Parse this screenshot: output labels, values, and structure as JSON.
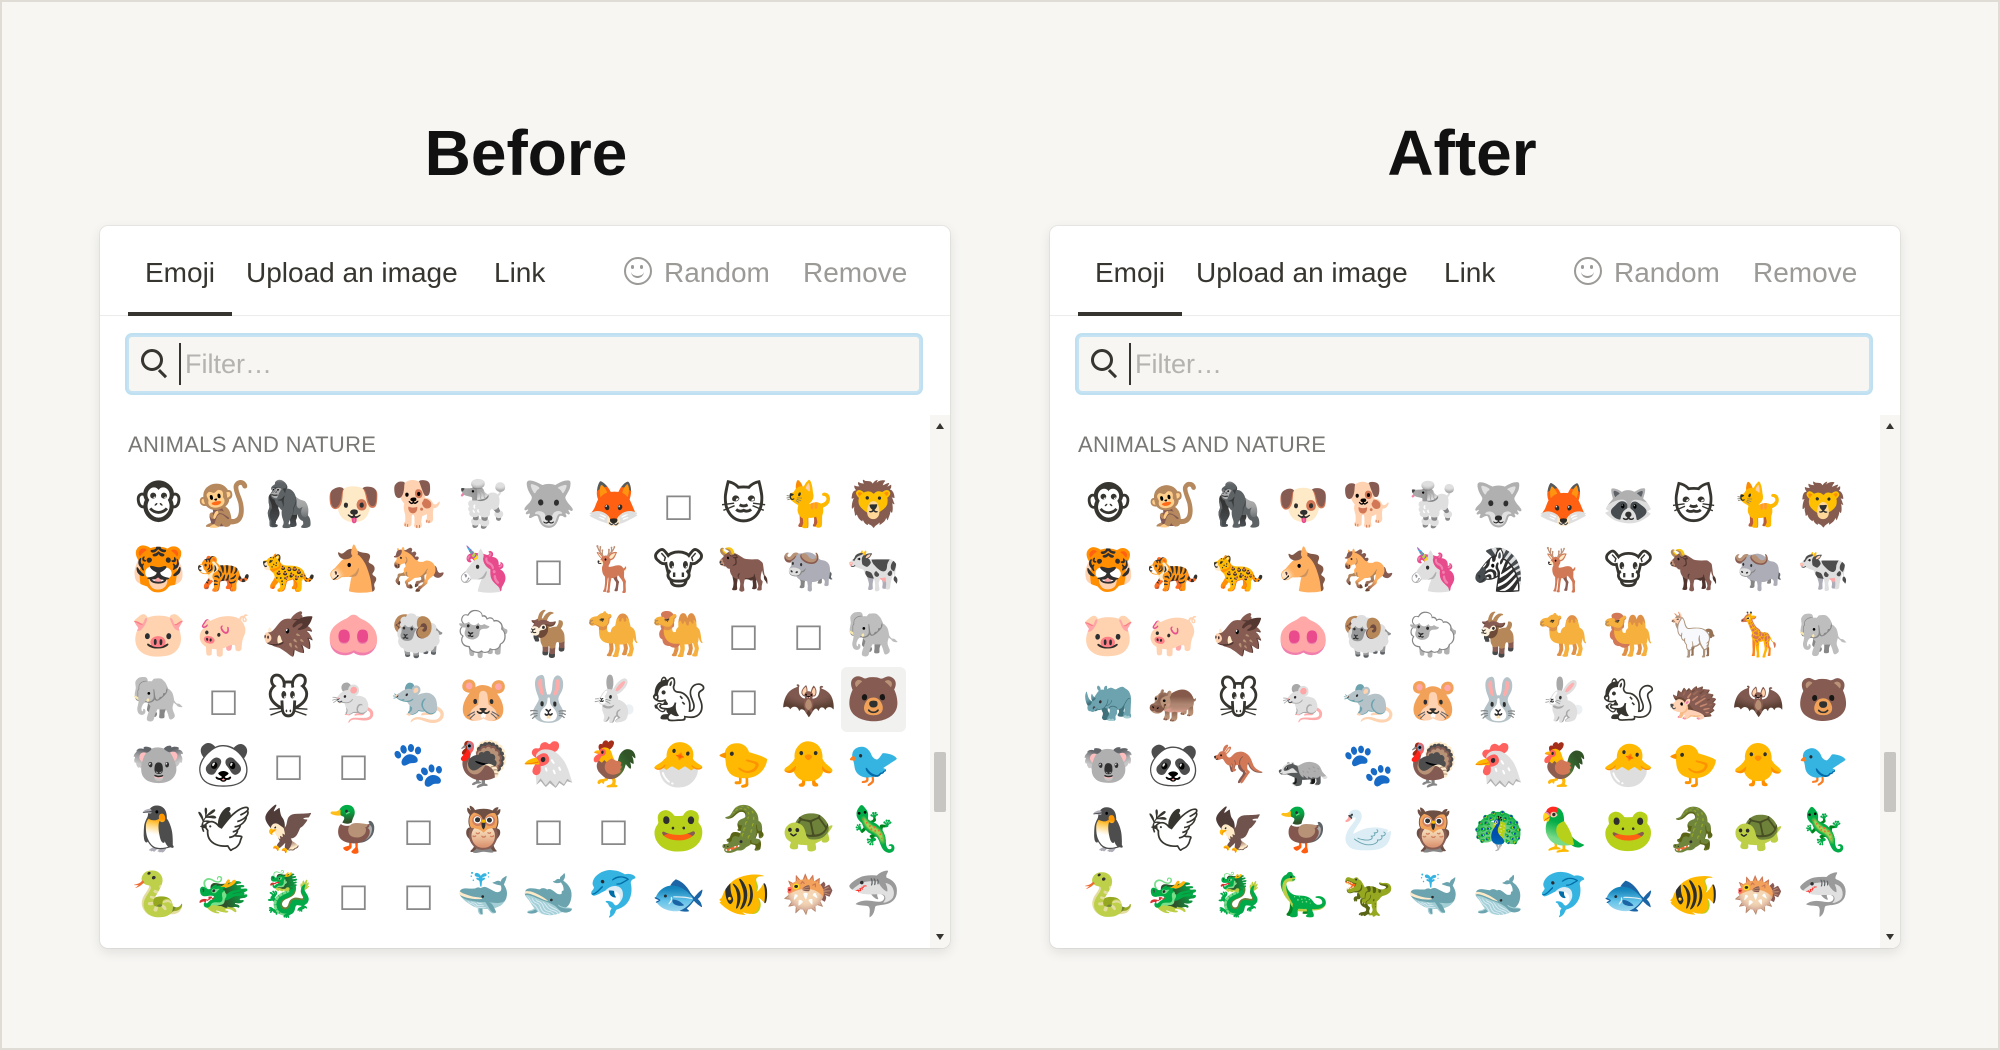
{
  "headings": {
    "before": "Before",
    "after": "After"
  },
  "tabs": {
    "emoji": "Emoji",
    "upload": "Upload an image",
    "link": "Link"
  },
  "actions": {
    "random": "Random",
    "remove": "Remove"
  },
  "search": {
    "placeholder": "Filter…",
    "value": ""
  },
  "section": "ANIMALS AND NATURE",
  "icons": {
    "search": "search-icon",
    "random": "smiley-icon"
  },
  "colors": {
    "focus_ring": "#bfe0f1",
    "muted_text": "#9b9a97",
    "active_tab": "#37352f"
  },
  "before_grid": [
    "🐵",
    "🐒",
    "🦍",
    "🐶",
    "🐕",
    "🐩",
    "🐺",
    "🦊",
    "□",
    "🐱",
    "🐈",
    "🦁",
    "🐯",
    "🐅",
    "🐆",
    "🐴",
    "🐎",
    "🦄",
    "□",
    "🦌",
    "🐮",
    "🐂",
    "🐃",
    "🐄",
    "🐷",
    "🐖",
    "🐗",
    "🐽",
    "🐏",
    "🐑",
    "🐐",
    "🐪",
    "🐫",
    "□",
    "□",
    "🐘",
    "🐘",
    "□",
    "🐭",
    "🐁",
    "🐀",
    "🐹",
    "🐰",
    "🐇",
    "🐿",
    "□",
    "🦇",
    "🐻",
    "🐨",
    "🐼",
    "□",
    "□",
    "🐾",
    "🦃",
    "🐔",
    "🐓",
    "🐣",
    "🐤",
    "🐥",
    "🐦",
    "🐧",
    "🕊",
    "🦅",
    "🦆",
    "□",
    "🦉",
    "□",
    "□",
    "🐸",
    "🐊",
    "🐢",
    "🦎",
    "🐍",
    "🐲",
    "🐉",
    "□",
    "□",
    "🐳",
    "🐋",
    "🐬",
    "🐟",
    "🐠",
    "🐡",
    "🦈"
  ],
  "after_grid": [
    "🐵",
    "🐒",
    "🦍",
    "🐶",
    "🐕",
    "🐩",
    "🐺",
    "🦊",
    "🦝",
    "🐱",
    "🐈",
    "🦁",
    "🐯",
    "🐅",
    "🐆",
    "🐴",
    "🐎",
    "🦄",
    "🦓",
    "🦌",
    "🐮",
    "🐂",
    "🐃",
    "🐄",
    "🐷",
    "🐖",
    "🐗",
    "🐽",
    "🐏",
    "🐑",
    "🐐",
    "🐪",
    "🐫",
    "🦙",
    "🦒",
    "🐘",
    "🦏",
    "🦛",
    "🐭",
    "🐁",
    "🐀",
    "🐹",
    "🐰",
    "🐇",
    "🐿",
    "🦔",
    "🦇",
    "🐻",
    "🐨",
    "🐼",
    "🦘",
    "🦡",
    "🐾",
    "🦃",
    "🐔",
    "🐓",
    "🐣",
    "🐤",
    "🐥",
    "🐦",
    "🐧",
    "🕊",
    "🦅",
    "🦆",
    "🦢",
    "🦉",
    "🦚",
    "🦜",
    "🐸",
    "🐊",
    "🐢",
    "🦎",
    "🐍",
    "🐲",
    "🐉",
    "🦕",
    "🦖",
    "🐳",
    "🐋",
    "🐬",
    "🐟",
    "🐠",
    "🐡",
    "🦈"
  ],
  "before_hover_index": 47
}
